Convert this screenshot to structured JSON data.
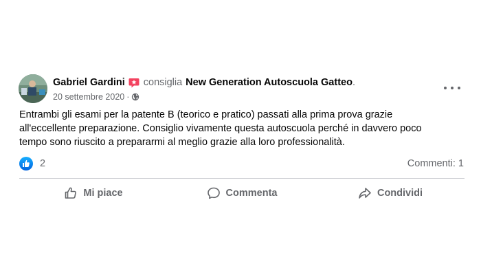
{
  "post": {
    "author": "Gabriel Gardini",
    "action_text": "consiglia",
    "page_name": "New Generation Autoscuola Gatteo",
    "period": ".",
    "date": "20 settembre 2020",
    "separator": "·",
    "privacy_icon": "globe-icon",
    "recommend_badge_icon": "recommend-badge-icon",
    "more_icon": "more-options-icon",
    "text_lines": [
      "Entrambi gli esami per la patente B (teorico e pratico) passati alla prima prova grazie",
      "all'eccellente preparazione. Consiglio vivamente questa autoscuola perché in davvero poco",
      "tempo sono riuscito a prepararmi al meglio grazie alla loro professionalità."
    ]
  },
  "engagement": {
    "reaction_icon": "like-reaction-icon",
    "reaction_count": "2",
    "comments": "Commenti: 1"
  },
  "actions": {
    "like_label": "Mi piace",
    "comment_label": "Commenta",
    "share_label": "Condividi",
    "like_icon": "thumbs-up-icon",
    "comment_icon": "comment-icon",
    "share_icon": "share-icon"
  },
  "colors": {
    "text_primary": "#050505",
    "text_secondary": "#65676b",
    "like_blue": "#1877f2",
    "recommend_red": "#f3425f",
    "divider": "#ced0d4"
  }
}
